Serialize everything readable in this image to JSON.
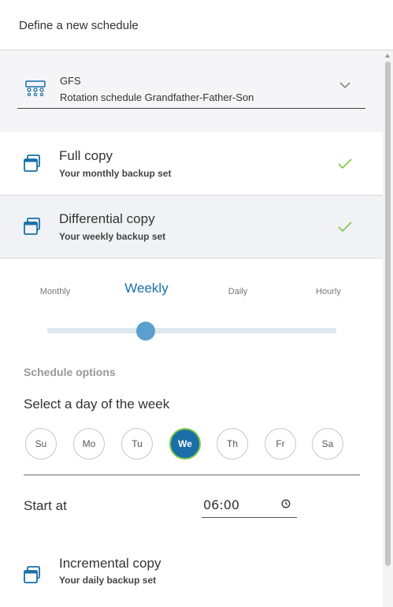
{
  "header": {
    "title": "Define a new schedule"
  },
  "rotation": {
    "name": "GFS",
    "description": "Rotation schedule Grandfather-Father-Son",
    "icon": "rotation-schedule-icon"
  },
  "copies": [
    {
      "title": "Full copy",
      "subtitle": "Your monthly backup set",
      "checked": true,
      "icon": "backup-set-icon"
    },
    {
      "title": "Differential copy",
      "subtitle": "Your weekly backup set",
      "checked": true,
      "icon": "backup-set-icon"
    },
    {
      "title": "Incremental copy",
      "subtitle": "Your daily backup set",
      "icon": "backup-set-icon"
    }
  ],
  "frequency": {
    "options": [
      "Monthly",
      "Weekly",
      "Daily",
      "Hourly"
    ],
    "selected": "Weekly",
    "slider_value_fraction": 0.34
  },
  "schedule_options": {
    "section_title": "Schedule options",
    "day_prompt": "Select a day of the week",
    "days": [
      "Su",
      "Mo",
      "Tu",
      "We",
      "Th",
      "Fr",
      "Sa"
    ],
    "selected_day": "We",
    "start_label": "Start at",
    "start_time": "06:00"
  },
  "colors": {
    "accent": "#1a6fa8",
    "check": "#7dc84a",
    "slider_track": "#dde9ef",
    "slider_thumb": "#5b9fcf",
    "selected_row_bg": "#f1f2f5"
  }
}
